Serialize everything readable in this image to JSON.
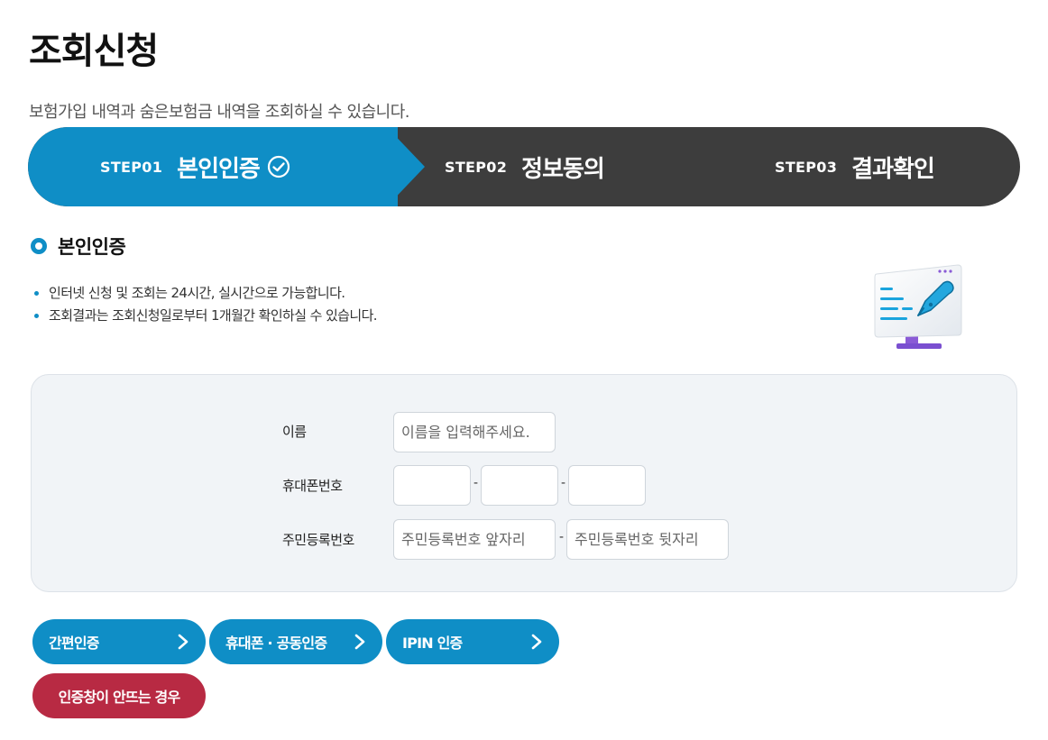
{
  "header": {
    "title": "조회신청",
    "description": "보험가입 내역과 숨은보험금 내역을 조회하실 수 있습니다."
  },
  "steps": [
    {
      "num": "STEP01",
      "label": "본인인증",
      "active": true
    },
    {
      "num": "STEP02",
      "label": "정보동의",
      "active": false
    },
    {
      "num": "STEP03",
      "label": "결과확인",
      "active": false
    }
  ],
  "section": {
    "title": "본인인증",
    "notes": [
      "인터넷 신청 및 조회는 24시간, 실시간으로 가능합니다.",
      "조회결과는 조회신청일로부터 1개월간 확인하실 수 있습니다."
    ]
  },
  "form": {
    "name_label": "이름",
    "name_placeholder": "이름을 입력해주세요.",
    "phone_label": "휴대폰번호",
    "phone_separator": "-",
    "rrn_label": "주민등록번호",
    "rrn_front_placeholder": "주민등록번호 앞자리",
    "rrn_back_placeholder": "주민등록번호 뒷자리",
    "rrn_separator": "-"
  },
  "buttons": {
    "simple_auth": "간편인증",
    "phone_cert_auth": "휴대폰 · 공동인증",
    "ipin_auth": "IPIN 인증",
    "popup_help": "인증창이 안뜨는 경우"
  },
  "colors": {
    "primary": "#0f8ec6",
    "step_bar": "#3d3d3d",
    "help_button": "#b82a43"
  }
}
